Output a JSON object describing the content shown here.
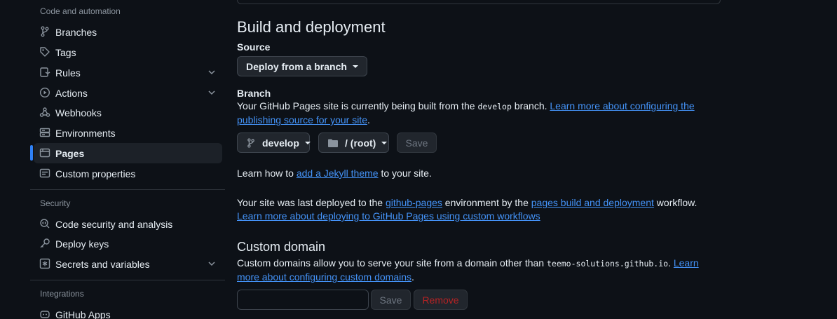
{
  "sidebar": {
    "groups": {
      "code_automation": "Code and automation",
      "security": "Security",
      "integrations": "Integrations"
    },
    "items": {
      "branches": "Branches",
      "tags": "Tags",
      "rules": "Rules",
      "actions": "Actions",
      "webhooks": "Webhooks",
      "environments": "Environments",
      "pages": "Pages",
      "custom_properties": "Custom properties",
      "code_security": "Code security and analysis",
      "deploy_keys": "Deploy keys",
      "secrets": "Secrets and variables",
      "github_apps": "GitHub Apps"
    }
  },
  "build": {
    "title": "Build and deployment",
    "source_label": "Source",
    "source_value": "Deploy from a branch",
    "branch_label": "Branch",
    "branch_text_1": "Your GitHub Pages site is currently being built from the ",
    "branch_code": "develop",
    "branch_text_2": " branch. ",
    "branch_link": "Learn more about configuring the publishing source for your site",
    "branch_period": ".",
    "branch_select": "develop",
    "folder_select": "/ (root)",
    "save": "Save",
    "jekyll_1": "Learn how to ",
    "jekyll_link": "add a Jekyll theme",
    "jekyll_2": " to your site.",
    "deployed_1": "Your site was last deployed to the ",
    "deployed_env": "github-pages",
    "deployed_2": " environment by the ",
    "deployed_workflow": "pages build and deployment",
    "deployed_3": " workflow.",
    "custom_workflows_link": "Learn more about deploying to GitHub Pages using custom workflows"
  },
  "custom_domain": {
    "title": "Custom domain",
    "text_1": "Custom domains allow you to serve your site from a domain other than ",
    "domain_code": "teemo-solutions.github.io",
    "text_2": ". ",
    "link": "Learn more about configuring custom domains",
    "period": ".",
    "input_value": "",
    "save": "Save",
    "remove": "Remove"
  }
}
